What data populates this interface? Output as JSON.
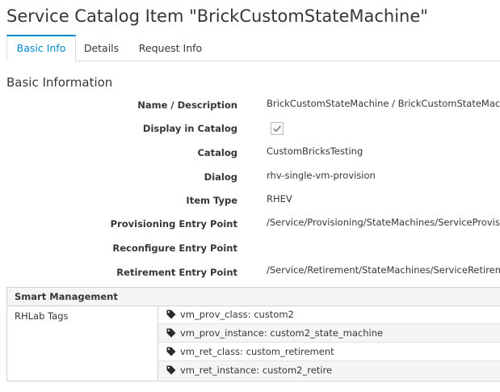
{
  "page": {
    "title": "Service Catalog Item \"BrickCustomStateMachine\""
  },
  "tabs": [
    {
      "label": "Basic Info",
      "active": true
    },
    {
      "label": "Details",
      "active": false
    },
    {
      "label": "Request Info",
      "active": false
    }
  ],
  "basic_info": {
    "heading": "Basic Information",
    "fields": {
      "name_description": {
        "label": "Name / Description",
        "value": "BrickCustomStateMachine / BrickCustomStateMachine"
      },
      "display_in_catalog": {
        "label": "Display in Catalog",
        "checked": true
      },
      "catalog": {
        "label": "Catalog",
        "value": "CustomBricksTesting"
      },
      "dialog": {
        "label": "Dialog",
        "value": "rhv-single-vm-provision"
      },
      "item_type": {
        "label": "Item Type",
        "value": "RHEV"
      },
      "provisioning_entry_point": {
        "label": "Provisioning Entry Point",
        "value": "/Service/Provisioning/StateMachines/ServiceProvision_Te"
      },
      "reconfigure_entry_point": {
        "label": "Reconfigure Entry Point",
        "value": ""
      },
      "retirement_entry_point": {
        "label": "Retirement Entry Point",
        "value": "/Service/Retirement/StateMachines/ServiceRetirement/De"
      }
    }
  },
  "smart_management": {
    "heading": "Smart Management",
    "label": "RHLab Tags",
    "tags": [
      "vm_prov_class: custom2",
      "vm_prov_instance: custom2_state_machine",
      "vm_ret_class: custom_retirement",
      "vm_ret_instance: custom2_retire"
    ],
    "tag_icon": "tag-icon"
  },
  "colors": {
    "accent": "#0088ce",
    "text": "#363636",
    "border": "#d1d1d1",
    "header_bg": "#f5f5f5"
  }
}
